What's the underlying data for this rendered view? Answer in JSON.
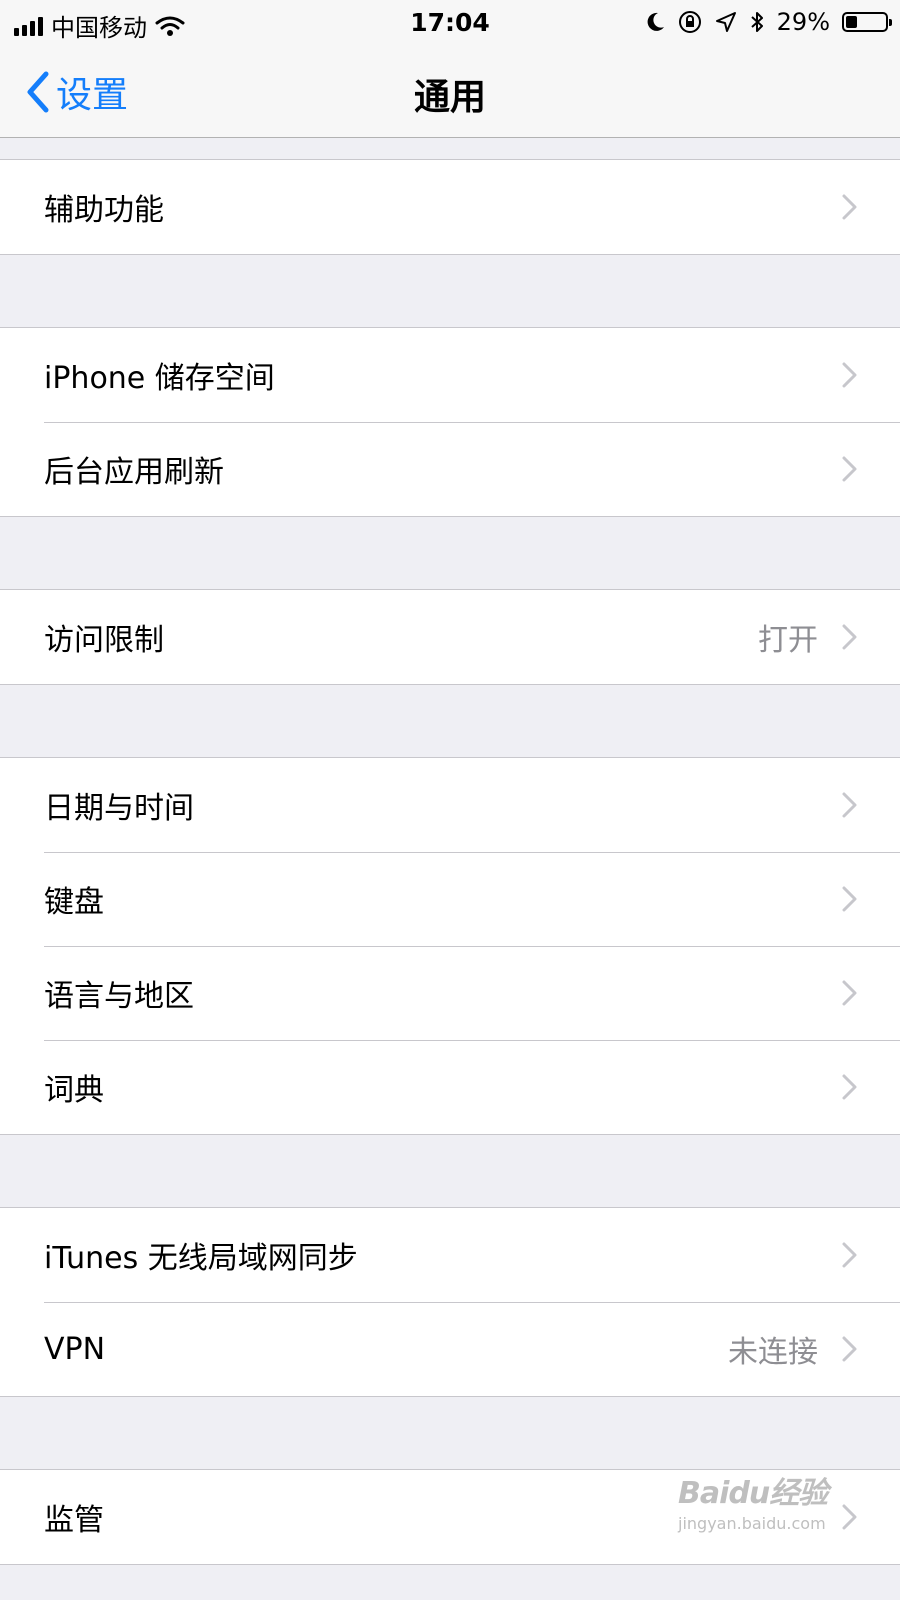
{
  "status": {
    "carrier": "中国移动",
    "time": "17:04",
    "battery_percent": "29%",
    "battery_level": 0.29
  },
  "nav": {
    "back_label": "设置",
    "title": "通用"
  },
  "groups": [
    {
      "items": [
        {
          "label": "辅助功能",
          "detail": ""
        }
      ]
    },
    {
      "items": [
        {
          "label": "iPhone 储存空间",
          "detail": ""
        },
        {
          "label": "后台应用刷新",
          "detail": ""
        }
      ]
    },
    {
      "items": [
        {
          "label": "访问限制",
          "detail": "打开"
        }
      ]
    },
    {
      "items": [
        {
          "label": "日期与时间",
          "detail": ""
        },
        {
          "label": "键盘",
          "detail": ""
        },
        {
          "label": "语言与地区",
          "detail": ""
        },
        {
          "label": "词典",
          "detail": ""
        }
      ]
    },
    {
      "items": [
        {
          "label": "iTunes 无线局域网同步",
          "detail": ""
        },
        {
          "label": "VPN",
          "detail": "未连接"
        }
      ]
    },
    {
      "items": [
        {
          "label": "监管",
          "detail": ""
        }
      ]
    }
  ],
  "watermark": {
    "brand": "Baidu经验",
    "url": "jingyan.baidu.com"
  },
  "icons": {
    "signal": "cellular-signal-icon",
    "wifi": "wifi-icon",
    "moon": "do-not-disturb-icon",
    "lock": "orientation-lock-icon",
    "location": "location-arrow-icon",
    "bluetooth": "bluetooth-icon",
    "battery": "battery-icon",
    "back": "chevron-left-icon",
    "row": "chevron-right-icon"
  },
  "colors": {
    "accent": "#147efb",
    "background": "#efeff4",
    "separator": "#c8c7cc",
    "detail_text": "#8e8e93"
  }
}
